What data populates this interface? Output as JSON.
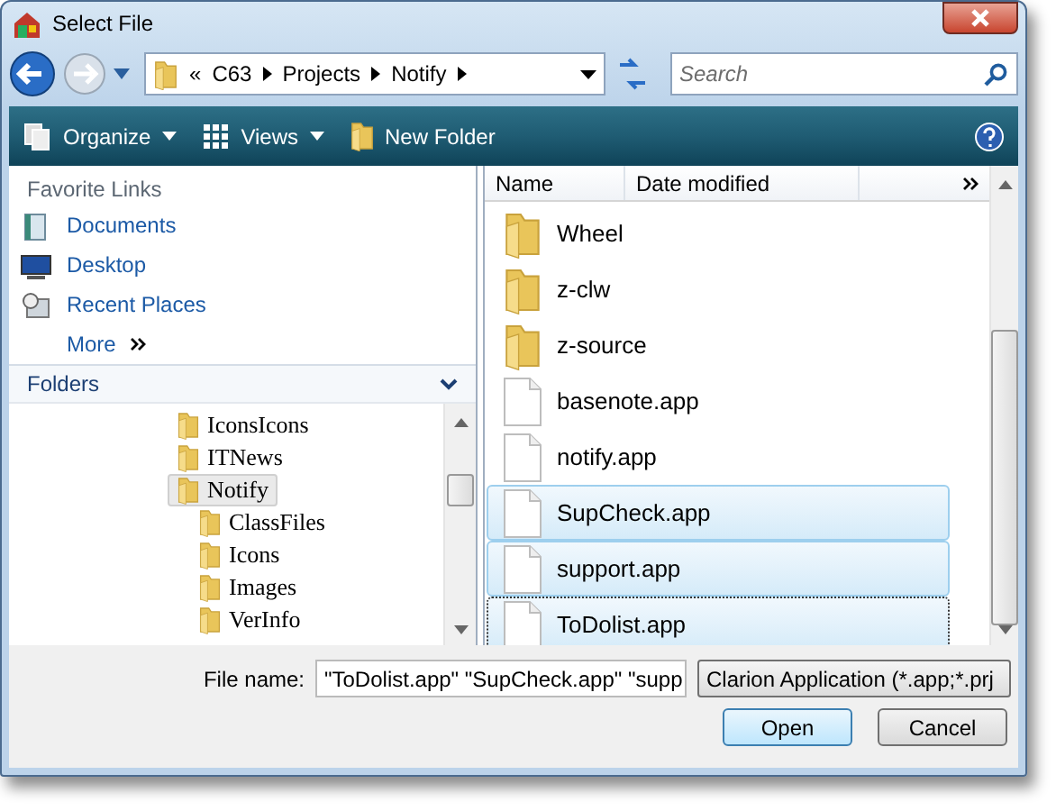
{
  "window": {
    "title": "Select File"
  },
  "address": {
    "prefix": "«",
    "path": [
      "C63",
      "Projects",
      "Notify"
    ]
  },
  "search": {
    "placeholder": "Search"
  },
  "toolbar": [
    {
      "label": "Organize",
      "kind": "organize"
    },
    {
      "label": "Views",
      "kind": "views"
    },
    {
      "label": "New Folder",
      "kind": "newfolder"
    }
  ],
  "favorite_links": {
    "title": "Favorite Links",
    "items": [
      {
        "label": "Documents",
        "kind": "documents"
      },
      {
        "label": "Desktop",
        "kind": "desktop"
      },
      {
        "label": "Recent Places",
        "kind": "recent"
      },
      {
        "label": "More",
        "kind": "more"
      }
    ]
  },
  "folders": {
    "title": "Folders",
    "tree": [
      {
        "label": "IconsIcons",
        "selected": false
      },
      {
        "label": "ITNews",
        "selected": false
      },
      {
        "label": "Notify",
        "selected": true,
        "children": [
          {
            "label": "ClassFiles",
            "selected": false
          },
          {
            "label": "Icons",
            "selected": false
          },
          {
            "label": "Images",
            "selected": false
          },
          {
            "label": "VerInfo",
            "selected": false
          }
        ]
      }
    ]
  },
  "file_list": {
    "columns": [
      "Name",
      "Date modified"
    ],
    "items": [
      {
        "name": "Wheel",
        "kind": "folder",
        "selected": false,
        "focused": false
      },
      {
        "name": "z-clw",
        "kind": "folder",
        "selected": false,
        "focused": false
      },
      {
        "name": "z-source",
        "kind": "folder",
        "selected": false,
        "focused": false
      },
      {
        "name": "basenote.app",
        "kind": "file",
        "selected": false,
        "focused": false
      },
      {
        "name": "notify.app",
        "kind": "file",
        "selected": false,
        "focused": false
      },
      {
        "name": "SupCheck.app",
        "kind": "file",
        "selected": true,
        "focused": false
      },
      {
        "name": "support.app",
        "kind": "file",
        "selected": true,
        "focused": false
      },
      {
        "name": "ToDolist.app",
        "kind": "file",
        "selected": true,
        "focused": true
      }
    ]
  },
  "file_name": {
    "label": "File name:",
    "value": "\"ToDolist.app\" \"SupCheck.app\" \"supp"
  },
  "file_type": {
    "value": "Clarion Application (*.app;*.prj"
  },
  "buttons": [
    {
      "label": "Open",
      "default": true
    },
    {
      "label": "Cancel",
      "default": false
    }
  ]
}
